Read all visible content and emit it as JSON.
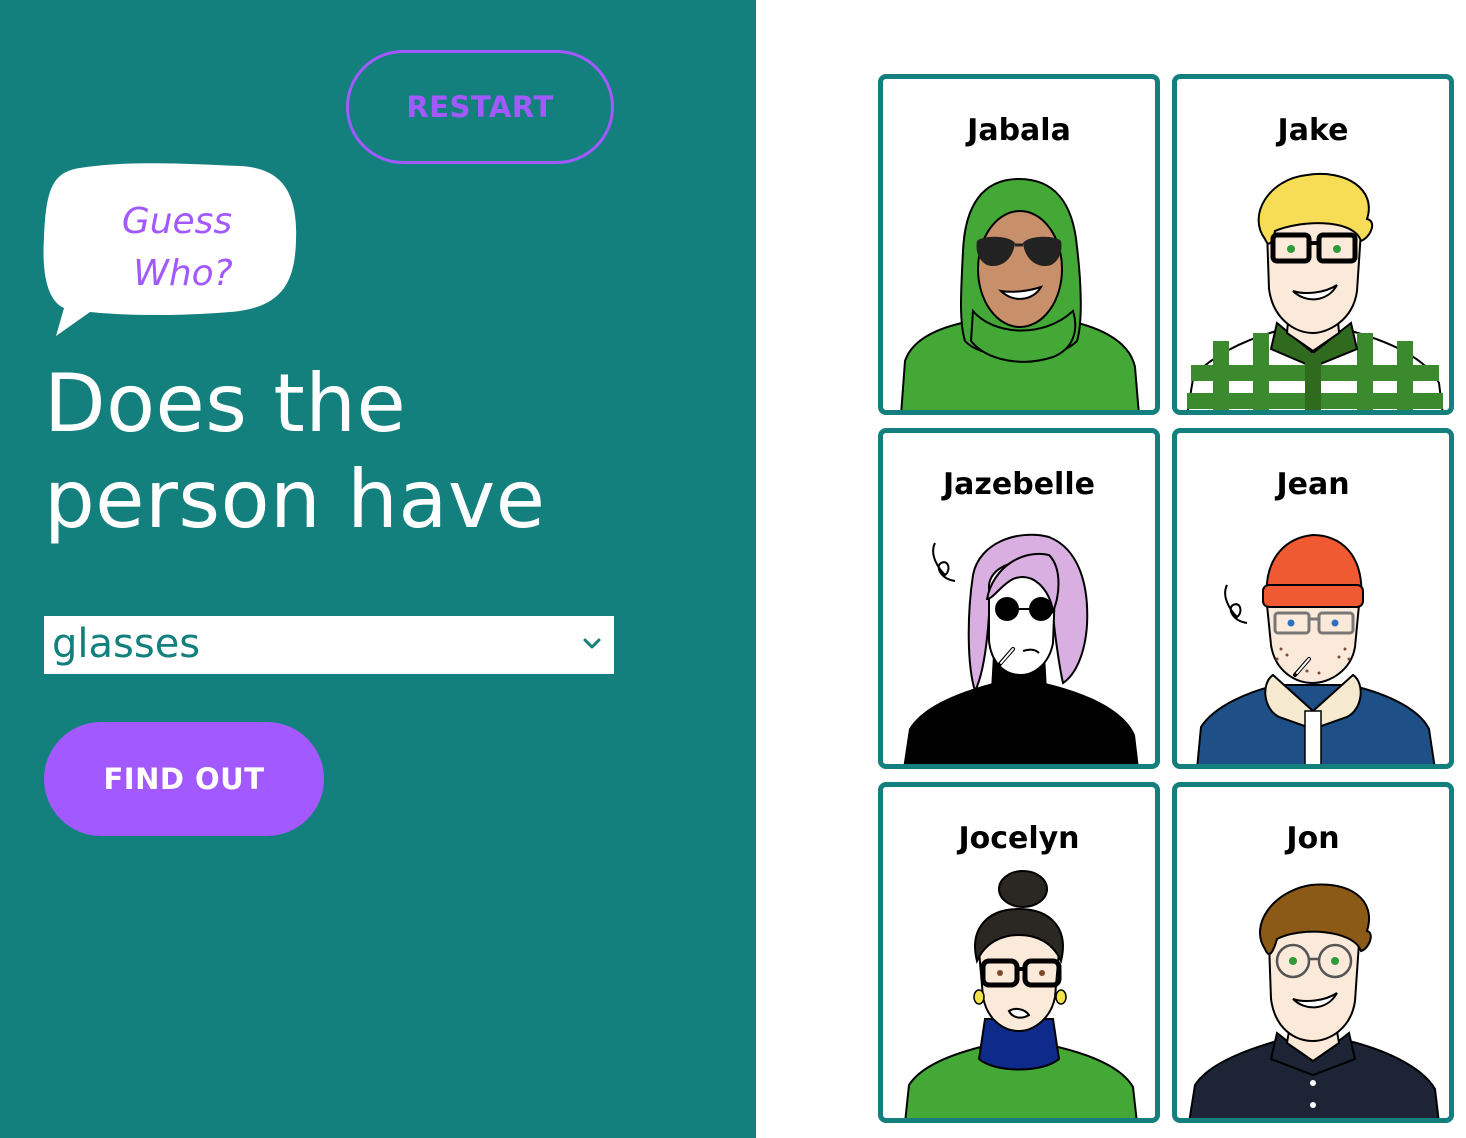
{
  "colors": {
    "panel": "#13807d",
    "accent": "#a259ff"
  },
  "restart_label": "RESTART",
  "bubble": {
    "line1": "Guess",
    "line2": "Who?"
  },
  "question": {
    "line1": "Does the",
    "line2": "person have"
  },
  "attribute_select": {
    "value": "glasses",
    "icon": "chevron-down-icon"
  },
  "find_out_label": "FIND OUT",
  "cards": [
    {
      "name": "Jabala"
    },
    {
      "name": "Jake"
    },
    {
      "name": "Jazebelle"
    },
    {
      "name": "Jean"
    },
    {
      "name": "Jocelyn"
    },
    {
      "name": "Jon"
    }
  ]
}
